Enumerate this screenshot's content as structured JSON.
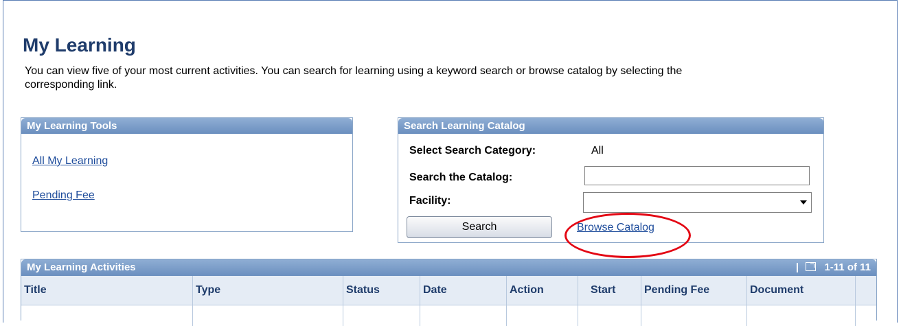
{
  "page": {
    "title": "My Learning",
    "intro": "You can view five of your most current activities. You can search for learning using a keyword search or browse catalog by selecting the corresponding link."
  },
  "tools": {
    "header": "My Learning Tools",
    "links": [
      "All My Learning",
      "Pending Fee"
    ]
  },
  "search": {
    "header": "Search Learning Catalog",
    "category_label": "Select Search Category:",
    "category_value": "All",
    "catalog_label": "Search the Catalog:",
    "catalog_value": "",
    "facility_label": "Facility:",
    "facility_value": "",
    "search_button": "Search",
    "browse_link": "Browse Catalog"
  },
  "annotation": {
    "color": "#e30613"
  },
  "activities": {
    "header": "My Learning Activities",
    "range": "1-11 of 11",
    "columns": [
      "Title",
      "Type",
      "Status",
      "Date",
      "Action",
      "Start",
      "Pending Fee",
      "Document"
    ]
  },
  "colors": {
    "header_blue": "#6b8fbf",
    "title_blue": "#1f3c6b",
    "link_blue": "#1f4d9c"
  }
}
